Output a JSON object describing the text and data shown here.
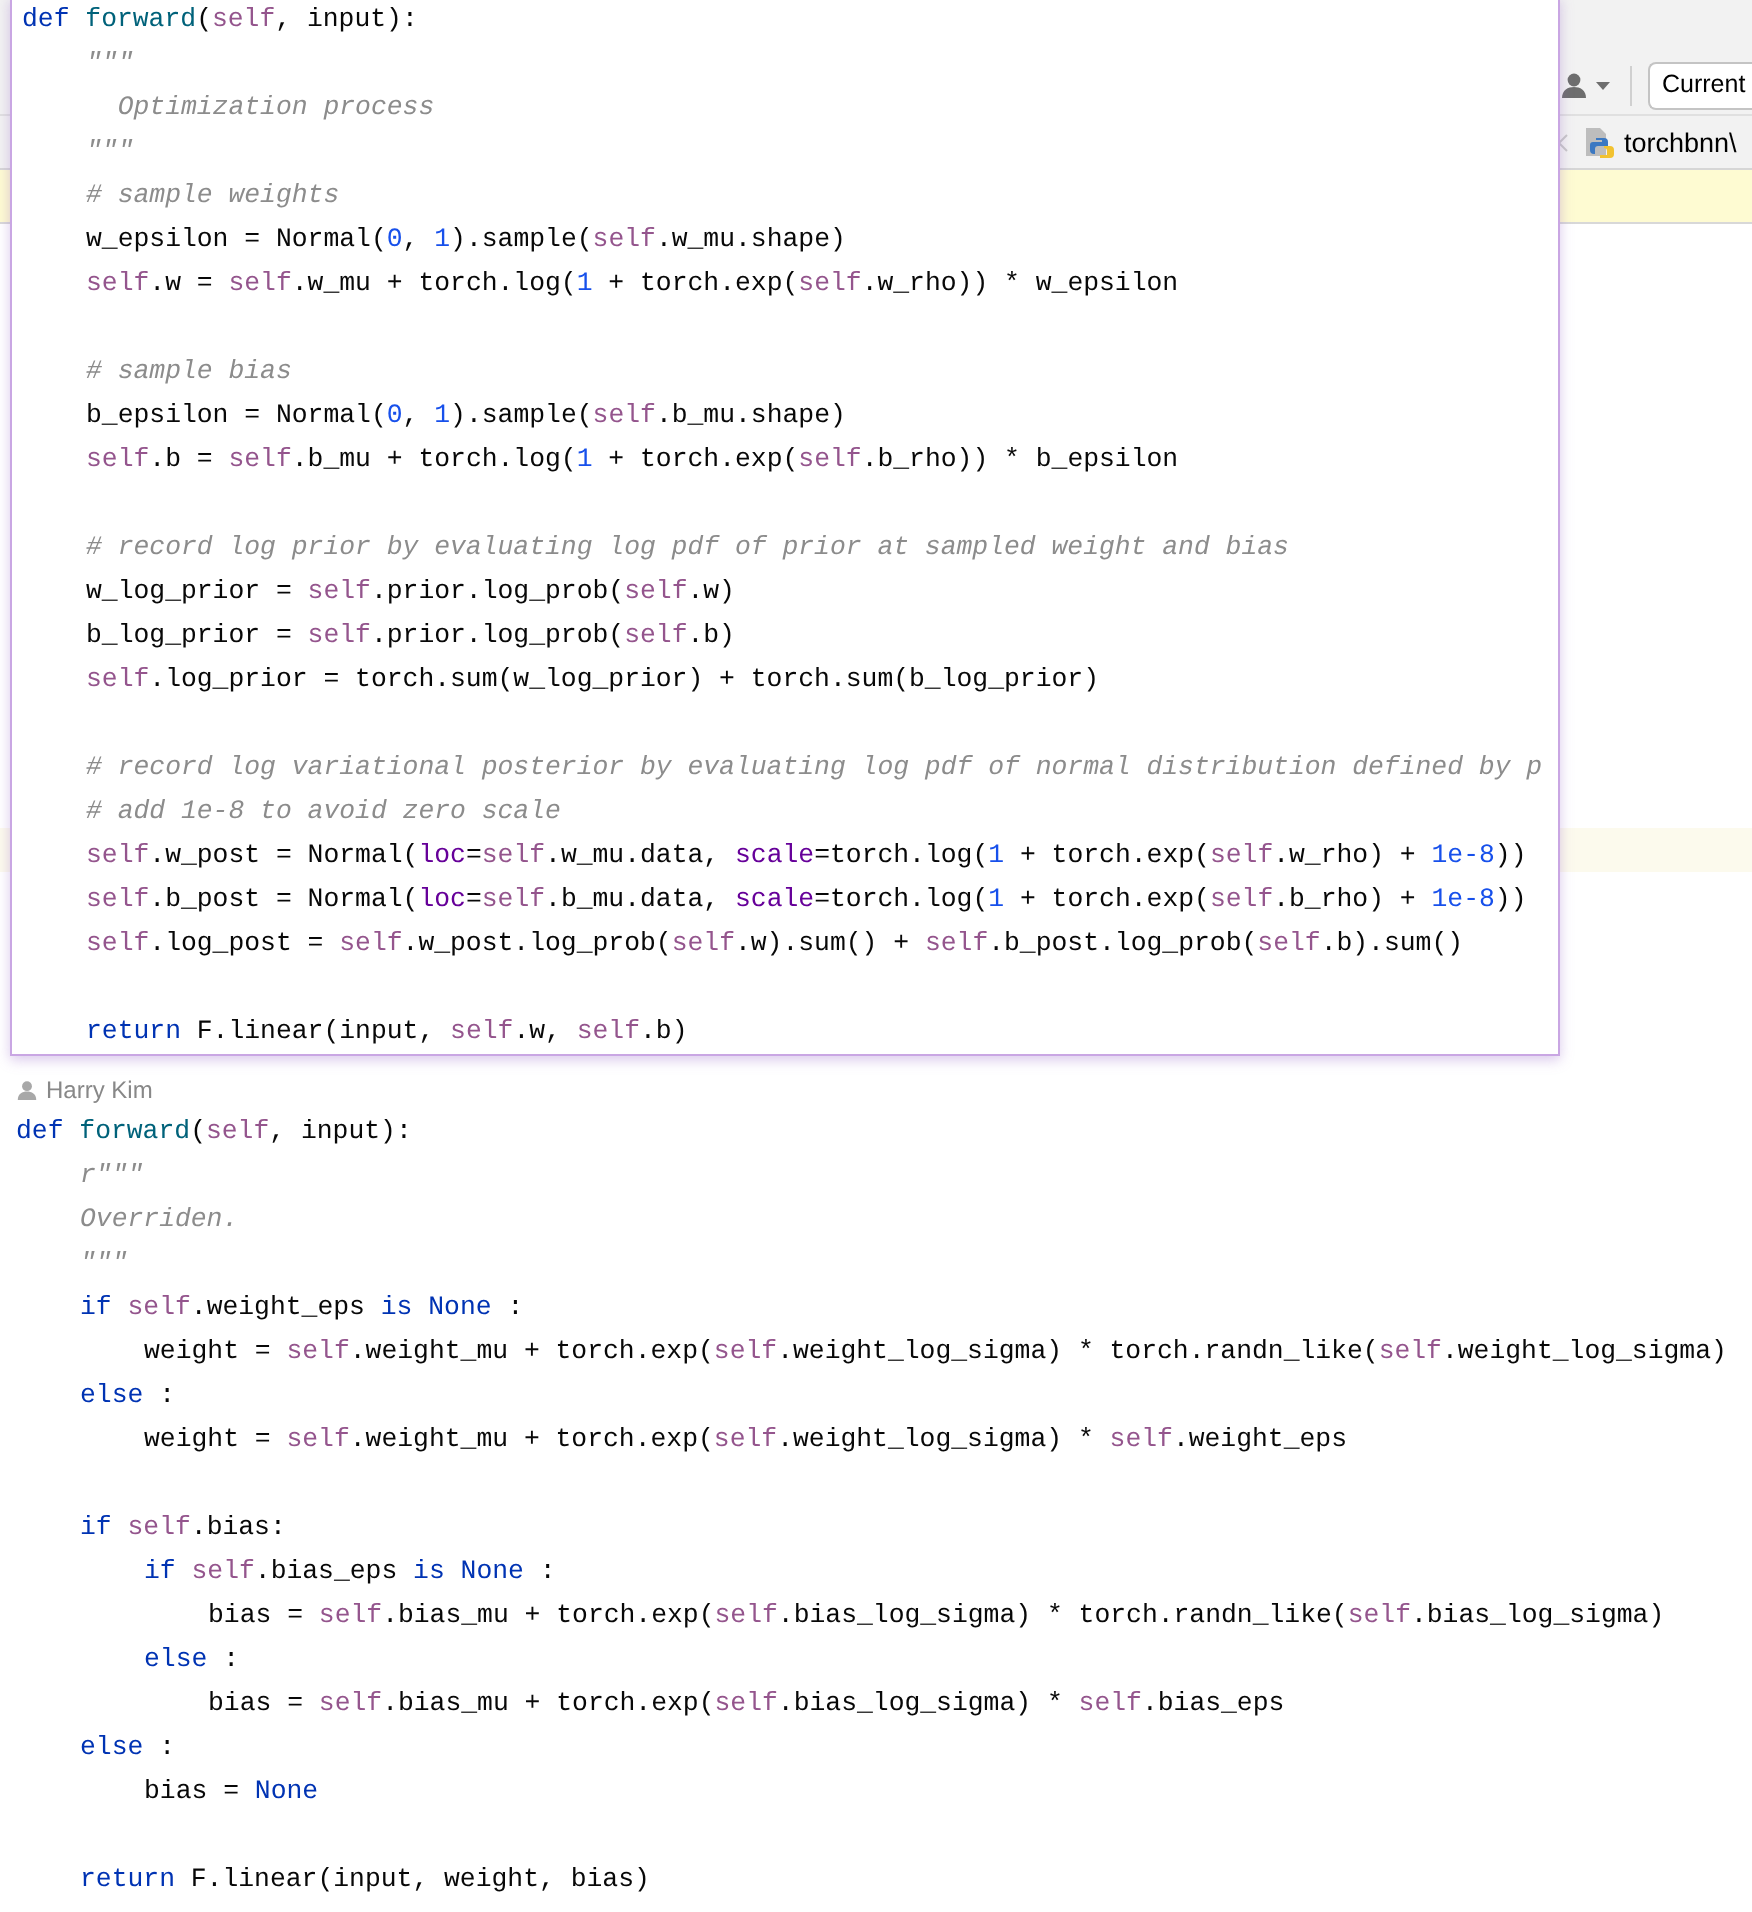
{
  "toolbar": {
    "scope_field": "Current"
  },
  "breadcrumb": {
    "file": "torchbnn\\"
  },
  "popup": {
    "lines": [
      {
        "tokens": [
          {
            "kind": "kw",
            "text": "def "
          },
          {
            "kind": "fn",
            "text": "forward"
          },
          {
            "kind": "p",
            "text": "("
          },
          {
            "kind": "self",
            "text": "self"
          },
          {
            "kind": "p",
            "text": ", input):"
          }
        ],
        "blocks": [
          [
            {
              "tokens": [
                {
                  "kind": "cm",
                  "text": "\"\"\""
                }
              ]
            },
            {
              "tokens": [
                {
                  "kind": "cm",
                  "text": "  Optimization process"
                }
              ]
            },
            {
              "tokens": [
                {
                  "kind": "cm",
                  "text": "\"\"\""
                }
              ]
            },
            {
              "tokens": [
                {
                  "kind": "cm",
                  "text": "# sample weights"
                }
              ]
            },
            {
              "tokens": [
                {
                  "kind": "p",
                  "text": "w_epsilon = Normal("
                },
                {
                  "kind": "num",
                  "text": "0"
                },
                {
                  "kind": "p",
                  "text": ", "
                },
                {
                  "kind": "num",
                  "text": "1"
                },
                {
                  "kind": "p",
                  "text": ").sample("
                },
                {
                  "kind": "self",
                  "text": "self"
                },
                {
                  "kind": "p",
                  "text": ".w_mu.shape)"
                }
              ]
            },
            {
              "tokens": [
                {
                  "kind": "self",
                  "text": "self"
                },
                {
                  "kind": "p",
                  "text": ".w = "
                },
                {
                  "kind": "self",
                  "text": "self"
                },
                {
                  "kind": "p",
                  "text": ".w_mu + torch.log("
                },
                {
                  "kind": "num",
                  "text": "1"
                },
                {
                  "kind": "p",
                  "text": " + torch.exp("
                },
                {
                  "kind": "self",
                  "text": "self"
                },
                {
                  "kind": "p",
                  "text": ".w_rho)) * w_epsilon"
                }
              ]
            }
          ],
          [
            {
              "tokens": [
                {
                  "kind": "cm",
                  "text": "# sample bias"
                }
              ]
            },
            {
              "tokens": [
                {
                  "kind": "p",
                  "text": "b_epsilon = Normal("
                },
                {
                  "kind": "num",
                  "text": "0"
                },
                {
                  "kind": "p",
                  "text": ", "
                },
                {
                  "kind": "num",
                  "text": "1"
                },
                {
                  "kind": "p",
                  "text": ").sample("
                },
                {
                  "kind": "self",
                  "text": "self"
                },
                {
                  "kind": "p",
                  "text": ".b_mu.shape)"
                }
              ]
            },
            {
              "tokens": [
                {
                  "kind": "self",
                  "text": "self"
                },
                {
                  "kind": "p",
                  "text": ".b = "
                },
                {
                  "kind": "self",
                  "text": "self"
                },
                {
                  "kind": "p",
                  "text": ".b_mu + torch.log("
                },
                {
                  "kind": "num",
                  "text": "1"
                },
                {
                  "kind": "p",
                  "text": " + torch.exp("
                },
                {
                  "kind": "self",
                  "text": "self"
                },
                {
                  "kind": "p",
                  "text": ".b_rho)) * b_epsilon"
                }
              ]
            }
          ],
          [
            {
              "tokens": [
                {
                  "kind": "cm",
                  "text": "# record log prior by evaluating log pdf of prior at sampled weight and bias"
                }
              ]
            },
            {
              "tokens": [
                {
                  "kind": "p",
                  "text": "w_log_prior = "
                },
                {
                  "kind": "self",
                  "text": "self"
                },
                {
                  "kind": "p",
                  "text": ".prior.log_prob("
                },
                {
                  "kind": "self",
                  "text": "self"
                },
                {
                  "kind": "p",
                  "text": ".w)"
                }
              ]
            },
            {
              "tokens": [
                {
                  "kind": "p",
                  "text": "b_log_prior = "
                },
                {
                  "kind": "self",
                  "text": "self"
                },
                {
                  "kind": "p",
                  "text": ".prior.log_prob("
                },
                {
                  "kind": "self",
                  "text": "self"
                },
                {
                  "kind": "p",
                  "text": ".b)"
                }
              ]
            },
            {
              "tokens": [
                {
                  "kind": "self",
                  "text": "self"
                },
                {
                  "kind": "p",
                  "text": ".log_prior = torch.sum(w_log_prior) + torch.sum(b_log_prior)"
                }
              ]
            }
          ],
          [
            {
              "tokens": [
                {
                  "kind": "cm",
                  "text": "# record log variational posterior by evaluating log pdf of normal distribution defined by p"
                }
              ]
            },
            {
              "tokens": [
                {
                  "kind": "cm",
                  "text": "# add 1e-8 to avoid zero scale"
                }
              ]
            },
            {
              "tokens": [
                {
                  "kind": "self",
                  "text": "self"
                },
                {
                  "kind": "p",
                  "text": ".w_post = Normal("
                },
                {
                  "kind": "arg",
                  "text": "loc"
                },
                {
                  "kind": "p",
                  "text": "="
                },
                {
                  "kind": "self",
                  "text": "self"
                },
                {
                  "kind": "p",
                  "text": ".w_mu.data, "
                },
                {
                  "kind": "arg",
                  "text": "scale"
                },
                {
                  "kind": "p",
                  "text": "=torch.log("
                },
                {
                  "kind": "num",
                  "text": "1"
                },
                {
                  "kind": "p",
                  "text": " + torch.exp("
                },
                {
                  "kind": "self",
                  "text": "self"
                },
                {
                  "kind": "p",
                  "text": ".w_rho) + "
                },
                {
                  "kind": "num",
                  "text": "1e-8"
                },
                {
                  "kind": "p",
                  "text": "))"
                }
              ]
            },
            {
              "tokens": [
                {
                  "kind": "self",
                  "text": "self"
                },
                {
                  "kind": "p",
                  "text": ".b_post = Normal("
                },
                {
                  "kind": "arg",
                  "text": "loc"
                },
                {
                  "kind": "p",
                  "text": "="
                },
                {
                  "kind": "self",
                  "text": "self"
                },
                {
                  "kind": "p",
                  "text": ".b_mu.data, "
                },
                {
                  "kind": "arg",
                  "text": "scale"
                },
                {
                  "kind": "p",
                  "text": "=torch.log("
                },
                {
                  "kind": "num",
                  "text": "1"
                },
                {
                  "kind": "p",
                  "text": " + torch.exp("
                },
                {
                  "kind": "self",
                  "text": "self"
                },
                {
                  "kind": "p",
                  "text": ".b_rho) + "
                },
                {
                  "kind": "num",
                  "text": "1e-8"
                },
                {
                  "kind": "p",
                  "text": "))"
                }
              ]
            },
            {
              "tokens": [
                {
                  "kind": "self",
                  "text": "self"
                },
                {
                  "kind": "p",
                  "text": ".log_post = "
                },
                {
                  "kind": "self",
                  "text": "self"
                },
                {
                  "kind": "p",
                  "text": ".w_post.log_prob("
                },
                {
                  "kind": "self",
                  "text": "self"
                },
                {
                  "kind": "p",
                  "text": ".w).sum() + "
                },
                {
                  "kind": "self",
                  "text": "self"
                },
                {
                  "kind": "p",
                  "text": ".b_post.log_prob("
                },
                {
                  "kind": "self",
                  "text": "self"
                },
                {
                  "kind": "p",
                  "text": ".b).sum()"
                }
              ]
            }
          ],
          [
            {
              "tokens": [
                {
                  "kind": "kw",
                  "text": "return"
                },
                {
                  "kind": "p",
                  "text": " F.linear(input, "
                },
                {
                  "kind": "self",
                  "text": "self"
                },
                {
                  "kind": "p",
                  "text": ".w, "
                },
                {
                  "kind": "self",
                  "text": "self"
                },
                {
                  "kind": "p",
                  "text": ".b)"
                }
              ]
            }
          ]
        ]
      }
    ]
  },
  "editor": {
    "annotation": "Harry Kim",
    "lines": [
      {
        "tokens": [
          {
            "kind": "kw",
            "text": "def "
          },
          {
            "kind": "fn",
            "text": "forward"
          },
          {
            "kind": "p",
            "text": "("
          },
          {
            "kind": "self",
            "text": "self"
          },
          {
            "kind": "p",
            "text": ", input):"
          }
        ],
        "blocks": [
          [
            {
              "tokens": [
                {
                  "kind": "cm",
                  "text": "r\"\"\""
                }
              ]
            },
            {
              "tokens": [
                {
                  "kind": "cm",
                  "text": "Overriden."
                }
              ]
            },
            {
              "tokens": [
                {
                  "kind": "cm",
                  "text": "\"\"\""
                }
              ]
            },
            {
              "tokens": [
                {
                  "kind": "kw",
                  "text": "if "
                },
                {
                  "kind": "self",
                  "text": "self"
                },
                {
                  "kind": "p",
                  "text": ".weight_eps "
                },
                {
                  "kind": "kw",
                  "text": "is None"
                },
                {
                  "kind": "p",
                  "text": " :"
                }
              ],
              "children": [
                {
                  "tokens": [
                    {
                      "kind": "p",
                      "text": "weight = "
                    },
                    {
                      "kind": "self",
                      "text": "self"
                    },
                    {
                      "kind": "p",
                      "text": ".weight_mu + torch.exp("
                    },
                    {
                      "kind": "self",
                      "text": "self"
                    },
                    {
                      "kind": "p",
                      "text": ".weight_log_sigma) * torch.randn_like("
                    },
                    {
                      "kind": "self",
                      "text": "self"
                    },
                    {
                      "kind": "p",
                      "text": ".weight_log_sigma)"
                    }
                  ]
                }
              ]
            },
            {
              "tokens": [
                {
                  "kind": "kw",
                  "text": "else"
                },
                {
                  "kind": "p",
                  "text": " :"
                }
              ],
              "children": [
                {
                  "tokens": [
                    {
                      "kind": "p",
                      "text": "weight = "
                    },
                    {
                      "kind": "self",
                      "text": "self"
                    },
                    {
                      "kind": "p",
                      "text": ".weight_mu + torch.exp("
                    },
                    {
                      "kind": "self",
                      "text": "self"
                    },
                    {
                      "kind": "p",
                      "text": ".weight_log_sigma) * "
                    },
                    {
                      "kind": "self",
                      "text": "self"
                    },
                    {
                      "kind": "p",
                      "text": ".weight_eps"
                    }
                  ]
                }
              ]
            }
          ],
          [
            {
              "tokens": [
                {
                  "kind": "kw",
                  "text": "if "
                },
                {
                  "kind": "self",
                  "text": "self"
                },
                {
                  "kind": "p",
                  "text": ".bias:"
                }
              ],
              "children": [
                {
                  "tokens": [
                    {
                      "kind": "kw",
                      "text": "if "
                    },
                    {
                      "kind": "self",
                      "text": "self"
                    },
                    {
                      "kind": "p",
                      "text": ".bias_eps "
                    },
                    {
                      "kind": "kw",
                      "text": "is None"
                    },
                    {
                      "kind": "p",
                      "text": " :"
                    }
                  ],
                  "children": [
                    {
                      "tokens": [
                        {
                          "kind": "p",
                          "text": "bias = "
                        },
                        {
                          "kind": "self",
                          "text": "self"
                        },
                        {
                          "kind": "p",
                          "text": ".bias_mu + torch.exp("
                        },
                        {
                          "kind": "self",
                          "text": "self"
                        },
                        {
                          "kind": "p",
                          "text": ".bias_log_sigma) * torch.randn_like("
                        },
                        {
                          "kind": "self",
                          "text": "self"
                        },
                        {
                          "kind": "p",
                          "text": ".bias_log_sigma)"
                        }
                      ]
                    }
                  ]
                },
                {
                  "tokens": [
                    {
                      "kind": "kw",
                      "text": "else"
                    },
                    {
                      "kind": "p",
                      "text": " :"
                    }
                  ],
                  "children": [
                    {
                      "tokens": [
                        {
                          "kind": "p",
                          "text": "bias = "
                        },
                        {
                          "kind": "self",
                          "text": "self"
                        },
                        {
                          "kind": "p",
                          "text": ".bias_mu + torch.exp("
                        },
                        {
                          "kind": "self",
                          "text": "self"
                        },
                        {
                          "kind": "p",
                          "text": ".bias_log_sigma) * "
                        },
                        {
                          "kind": "self",
                          "text": "self"
                        },
                        {
                          "kind": "p",
                          "text": ".bias_eps"
                        }
                      ]
                    }
                  ]
                }
              ]
            },
            {
              "tokens": [
                {
                  "kind": "kw",
                  "text": "else"
                },
                {
                  "kind": "p",
                  "text": " :"
                }
              ],
              "children": [
                {
                  "tokens": [
                    {
                      "kind": "p",
                      "text": "bias = "
                    },
                    {
                      "kind": "kw",
                      "text": "None"
                    }
                  ]
                }
              ]
            }
          ],
          [
            {
              "tokens": [
                {
                  "kind": "kw",
                  "text": "return"
                },
                {
                  "kind": "p",
                  "text": " F.linear(input, weight, bias)"
                }
              ]
            }
          ]
        ]
      }
    ]
  }
}
